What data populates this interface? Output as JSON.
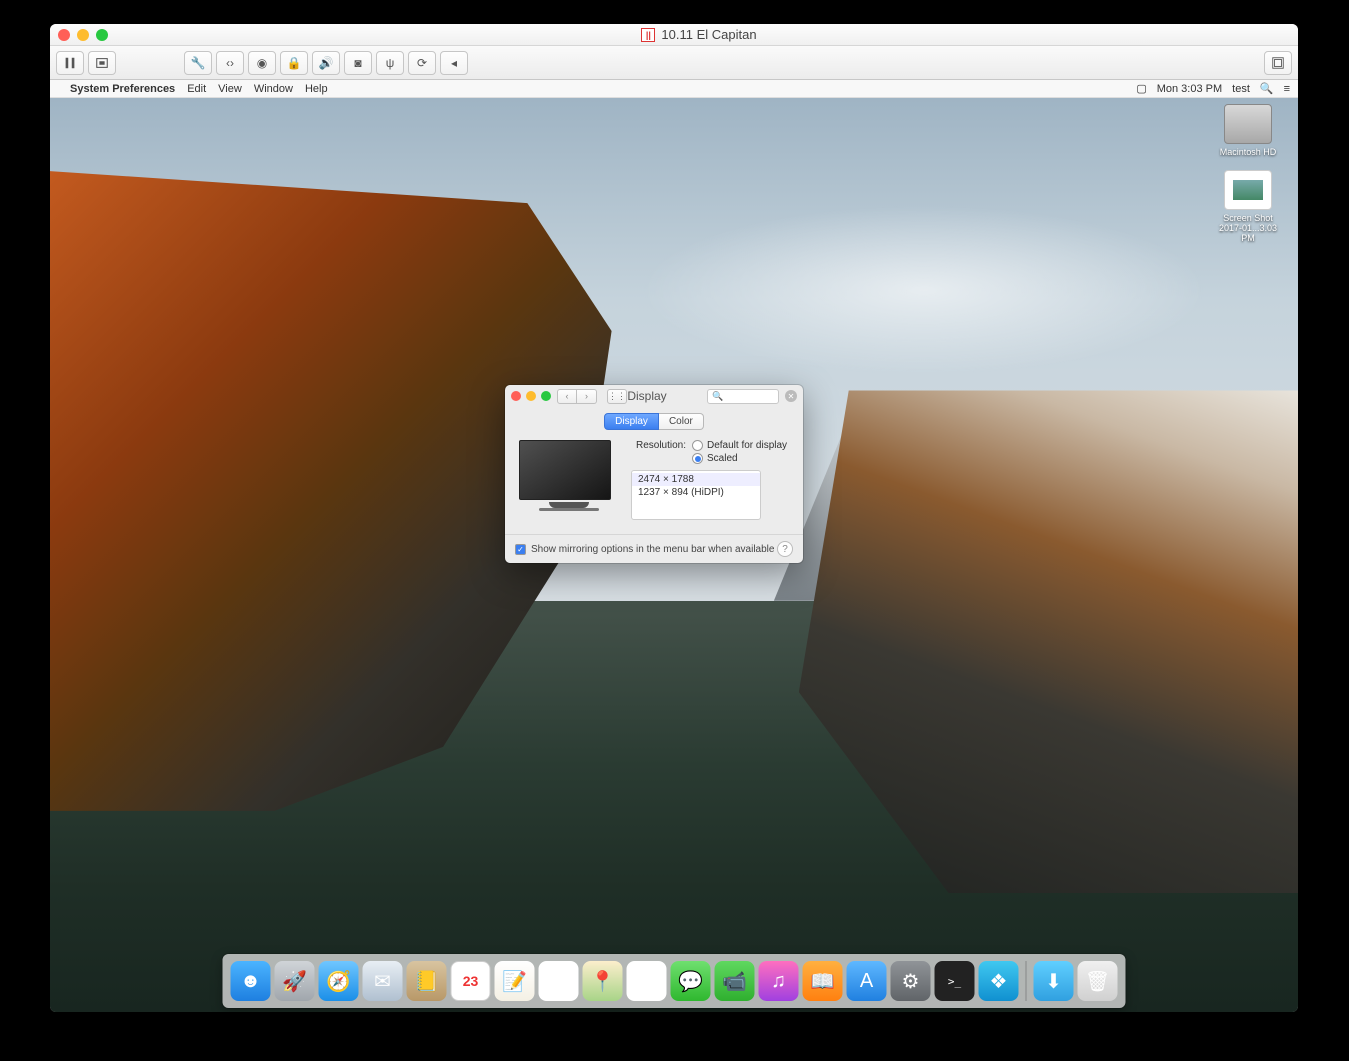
{
  "host": {
    "title": "10.11 El Capitan",
    "toolbar_icons": [
      "pause",
      "screenshot",
      "wrench",
      "resize-arrows",
      "disc",
      "lock",
      "volume",
      "camera",
      "usb",
      "sync",
      "chevron-left"
    ]
  },
  "guest_menubar": {
    "apple": "",
    "app": "System Preferences",
    "menus": [
      "Edit",
      "View",
      "Window",
      "Help"
    ],
    "right": {
      "time": "Mon 3:03 PM",
      "user": "test"
    }
  },
  "desktop_icons": {
    "hd": "Macintosh HD",
    "screenshot": "Screen Shot\n2017-01...3.03 PM"
  },
  "pref": {
    "title": "Display",
    "nav": {
      "back": "‹",
      "fwd": "›",
      "grid": "⋮⋮"
    },
    "search_placeholder": "",
    "tabs": [
      "Display",
      "Color"
    ],
    "active_tab": 0,
    "resolution_label": "Resolution:",
    "radio_default": "Default for display",
    "radio_scaled": "Scaled",
    "resolutions": [
      "2474 × 1788",
      "1237 × 894 (HiDPI)"
    ],
    "selected_resolution": 0,
    "footer_check": "Show mirroring options in the menu bar when available",
    "help": "?"
  },
  "dock": {
    "items": [
      {
        "name": "finder",
        "bg": "linear-gradient(#4bb4ff,#1e7fe0)",
        "glyph": "☻"
      },
      {
        "name": "launchpad",
        "bg": "linear-gradient(#d0d4d8,#a0a6ac)",
        "glyph": "🚀"
      },
      {
        "name": "safari",
        "bg": "linear-gradient(#6fc6ff,#1b8fe8)",
        "glyph": "🧭"
      },
      {
        "name": "mail",
        "bg": "linear-gradient(#e8eef4,#b0c0d0)",
        "glyph": "✉"
      },
      {
        "name": "contacts",
        "bg": "linear-gradient(#d8c4a0,#b89868)",
        "glyph": "📒"
      },
      {
        "name": "calendar",
        "bg": "#fff",
        "glyph": "23"
      },
      {
        "name": "notes",
        "bg": "linear-gradient(#fff,#f4f0e4)",
        "glyph": "📝"
      },
      {
        "name": "reminders",
        "bg": "#fff",
        "glyph": "☑"
      },
      {
        "name": "maps",
        "bg": "linear-gradient(#fceecc,#a8d488)",
        "glyph": "📍"
      },
      {
        "name": "photos",
        "bg": "#fff",
        "glyph": "✿"
      },
      {
        "name": "messages",
        "bg": "linear-gradient(#6fe06f,#2fb82f)",
        "glyph": "💬"
      },
      {
        "name": "facetime",
        "bg": "linear-gradient(#5fd85f,#2fb02f)",
        "glyph": "📹"
      },
      {
        "name": "itunes",
        "bg": "linear-gradient(#ff6fbf,#a040e0)",
        "glyph": "♫"
      },
      {
        "name": "ibooks",
        "bg": "linear-gradient(#ffb040,#ff8010)",
        "glyph": "📖"
      },
      {
        "name": "appstore",
        "bg": "linear-gradient(#5fb8ff,#2080e0)",
        "glyph": "A"
      },
      {
        "name": "sysprefs",
        "bg": "linear-gradient(#909498,#606468)",
        "glyph": "⚙"
      },
      {
        "name": "terminal",
        "bg": "#222",
        "glyph": ">_"
      },
      {
        "name": "parallels",
        "bg": "linear-gradient(#40c8f0,#1090d0)",
        "glyph": "❖"
      }
    ],
    "after_sep": [
      {
        "name": "downloads",
        "bg": "linear-gradient(#60cfff,#30a0e0)",
        "glyph": "⬇"
      },
      {
        "name": "trash",
        "bg": "linear-gradient(#f0f0f0,#d0d0d0)",
        "glyph": "🗑"
      }
    ]
  }
}
